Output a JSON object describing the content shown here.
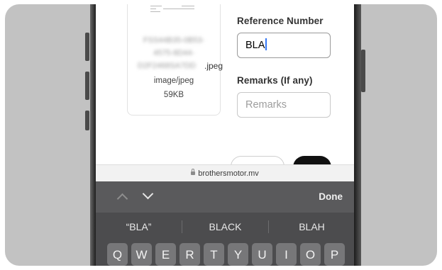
{
  "file_card": {
    "name_lines": [
      "FSS44B35-0B53-",
      "4575-8D44-",
      "D2F2468SA7DD"
    ],
    "extension": ".jpeg",
    "mime_type": "image/jpeg",
    "size": "59KB"
  },
  "form": {
    "reference_label": "Reference Number",
    "reference_value": "BLA",
    "remarks_label": "Remarks (If any)",
    "remarks_placeholder": "Remarks"
  },
  "browser": {
    "url": "brothersmotor.mv"
  },
  "keyboard": {
    "done_label": "Done",
    "suggestions": [
      "“BLA”",
      "BLACK",
      "BLAH"
    ],
    "keys": [
      "Q",
      "W",
      "E",
      "R",
      "T",
      "Y",
      "U",
      "I",
      "O",
      "P"
    ]
  }
}
